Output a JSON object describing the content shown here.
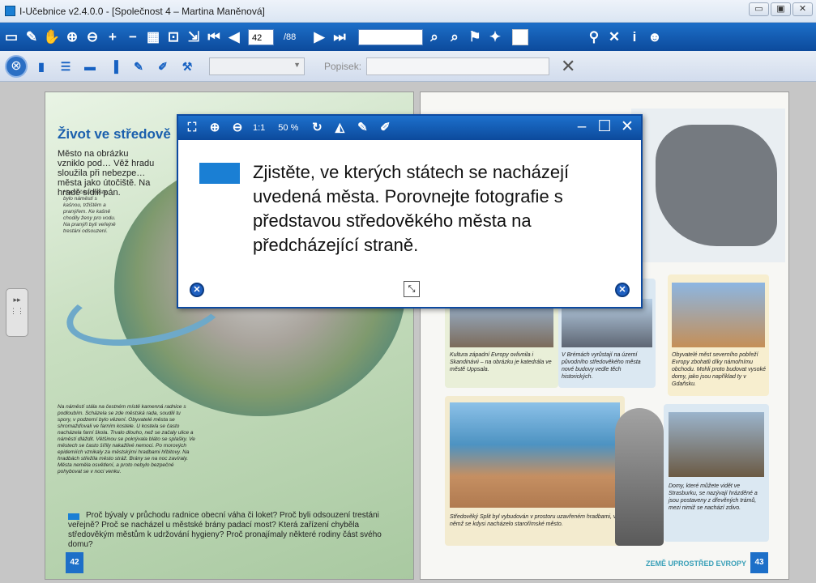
{
  "window": {
    "title": "I-Učebnice v2.4.0.0 - [Společnost 4 – Martina Maněnová]",
    "controls": [
      "▭",
      "▣",
      "✕"
    ]
  },
  "toolbar1": {
    "icons_left": [
      "new-page",
      "eraser",
      "hand",
      "zoom-in",
      "zoom-out",
      "zoom-plus",
      "zoom-minus",
      "grid",
      "fit-page",
      "fit-width"
    ],
    "nav_first": "⏮",
    "nav_prev": "◀",
    "page_current": "42",
    "page_total": "/88",
    "nav_next": "▶",
    "nav_last": "⏭",
    "icons_right": [
      "search-prev",
      "search-next",
      "flag",
      "google",
      "color-white"
    ]
  },
  "toolbar2": {
    "dropdown_value": "",
    "popisek_label": "Popisek:",
    "popisek_value": ""
  },
  "left_page": {
    "title": "Život ve středově",
    "intro": "Město na obrázku vzniklo pod… Věž hradu sloužila při nebezpe… města jako útočiště. Na hradě sídlil pán.",
    "side_note": "Hlavní částí města bylo náměstí s kašnou, tržištěm a pranýřem. Ke kašně chodily ženy pro vodu. Na pranýři byli veřejně trestáni odsouzení.",
    "bottom_note": "Na náměstí stála na čestném místě kamenná radnice s podloubím. Scházela se zde městská rada, soudili tu spory, v podzemí bylo vězení. Obyvatelé města se shromažďovali ve farním kostele. U kostela se často nacházela farní škola. Trvalo dlouho, než se začaly ulice a náměstí dláždit. Většinou se pokrývala bláto se splašky. Ve městech se často šířily nakažlivé nemoci. Po morových epidemiích vznikaly za městskými hradbami hřbitovy. Na hradbách střežila město stráž. Brány se na noc zavíraly. Města neměla osvětlení, a proto nebylo bezpečné pohybovat se v noci venku.",
    "question": "Proč bývaly v průchodu radnice obecní váha či loket? Proč byli odsouzení trestáni veřejně? Proč se nacházel u městské brány padací most? Která zařízení chyběla středověkým městům k udržování hygieny? Proč pronajímaly některé rodiny část svého domu?",
    "page_number": "42"
  },
  "right_page": {
    "caption1": "Kultura západní Evropy ovlivnila i Skandinávii – na obrázku je katedrála ve městě Uppsala.",
    "caption2": "V Brémách vyrůstají na území původního středověkého města nové budovy vedle těch historických.",
    "caption3": "Obyvatelé měst severního pobřeží Evropy zbohatli díky námořnímu obchodu. Mohli proto budovat vysoké domy, jako jsou například ty v Gdaňsku.",
    "caption4": "Středověký Split byl vybudován v prostoru uzavřeném hradbami, v němž se kdysi nacházelo starořímské město.",
    "caption5": "Domy, které můžete vidět ve Strasburku, se nazývají hrázděné a jsou postaveny z dřevěných trámů, mezi nimiž se nachází zdivo.",
    "footer": "ZEMĚ UPROSTŘED EVROPY",
    "page_number": "43"
  },
  "dialog": {
    "zoom_ratio": "1:1",
    "zoom_percent": "50 %",
    "text": "Zjistěte, ve kterých státech se nacházejí uvedená města. Porovnejte fotografie s představou středověkého města na předcházející straně.",
    "minimize": "–",
    "maximize": "☐",
    "close": "✕"
  },
  "colors": {
    "accent": "#1d6fc8",
    "dialog_square": "#1a7fd4"
  }
}
